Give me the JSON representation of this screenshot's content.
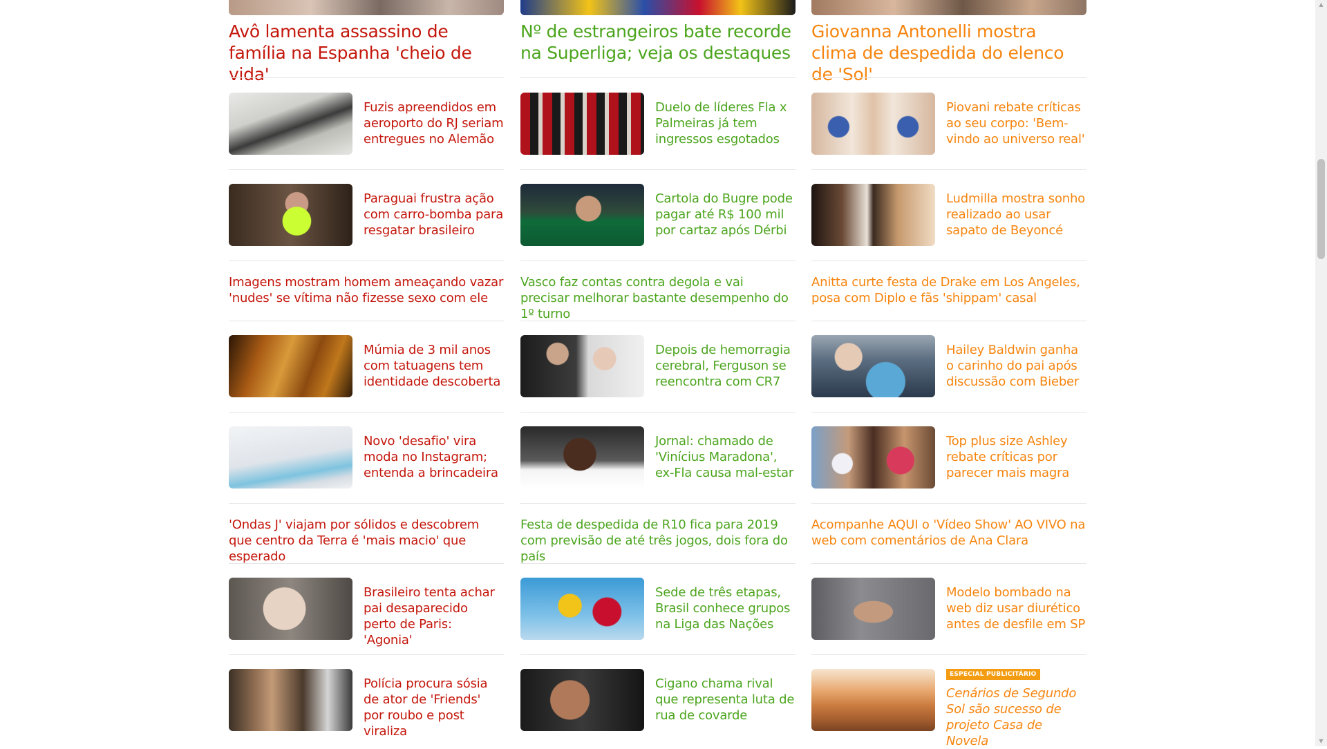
{
  "columns": [
    {
      "id": "news",
      "color": "#c4170c",
      "headline": "Avô lamenta assassino de família na Espanha 'cheio de vida'",
      "items": [
        {
          "title": "Fuzis apreendidos em aeroporto do RJ seriam entregues no Alemão"
        },
        {
          "title": "Paraguai frustra ação com carro-bomba para resgatar brasileiro"
        },
        {
          "text_only": "Imagens mostram homem ameaçando vazar 'nudes' se vítima não fizesse sexo com ele"
        },
        {
          "title": "Múmia de 3 mil anos com tatuagens tem identidade descoberta"
        },
        {
          "title": "Novo 'desafio' vira moda no Instagram; entenda a brincadeira"
        },
        {
          "text_only": "'Ondas J' viajam por sólidos e descobrem que centro da Terra é 'mais macio' que esperado"
        },
        {
          "title": "Brasileiro tenta achar pai desaparecido perto de Paris: 'Agonia'"
        },
        {
          "title": "Polícia procura sósia de ator de 'Friends' por roubo e post viraliza"
        }
      ]
    },
    {
      "id": "sports",
      "color": "#4ca51e",
      "headline": "Nº de estrangeiros bate recorde na Superliga; veja os destaques",
      "items": [
        {
          "title": "Duelo de líderes Fla x Palmeiras já tem ingressos esgotados"
        },
        {
          "title": "Cartola do Bugre pode pagar até R$ 100 mil por cartaz após Dérbi"
        },
        {
          "text_only": "Vasco faz contas contra degola e vai precisar melhorar bastante desempenho do 1º turno"
        },
        {
          "title": "Depois de hemorragia cerebral, Ferguson se reencontra com CR7"
        },
        {
          "title": "Jornal: chamado de 'Vinícius Maradona', ex-Fla causa mal-estar"
        },
        {
          "text_only": "Festa de despedida de R10 fica para 2019 com previsão de até três jogos, dois fora do país"
        },
        {
          "title": "Sede de três etapas, Brasil conhece grupos na Liga das Nações"
        },
        {
          "title": "Cigano chama rival que representa luta de rua de covarde"
        }
      ]
    },
    {
      "id": "entertainment",
      "color": "#f6850f",
      "headline": "Giovanna Antonelli mostra clima de despedida do elenco de 'Sol'",
      "items": [
        {
          "title": "Piovani rebate críticas ao seu corpo: 'Bem-vindo ao universo real'"
        },
        {
          "title": "Ludmilla mostra sonho realizado ao usar sapato de Beyoncé"
        },
        {
          "text_only": "Anitta curte festa de Drake em Los Angeles, posa com Diplo e fãs 'shippam' casal"
        },
        {
          "title": "Hailey Baldwin ganha o carinho do pai após discussão com Bieber"
        },
        {
          "title": "Top plus size Ashley rebate críticas por parecer mais magra"
        },
        {
          "text_only": "Acompanhe AQUI o 'Vídeo Show' AO VIVO na web com comentários de Ana Clara"
        },
        {
          "title": "Modelo bombado na web diz usar diurético antes de desfile em SP"
        },
        {
          "badge": "ESPECIAL PUBLICITÁRIO",
          "title": "Cenários de Segundo Sol são sucesso de projeto Casa de Novela"
        }
      ]
    }
  ]
}
